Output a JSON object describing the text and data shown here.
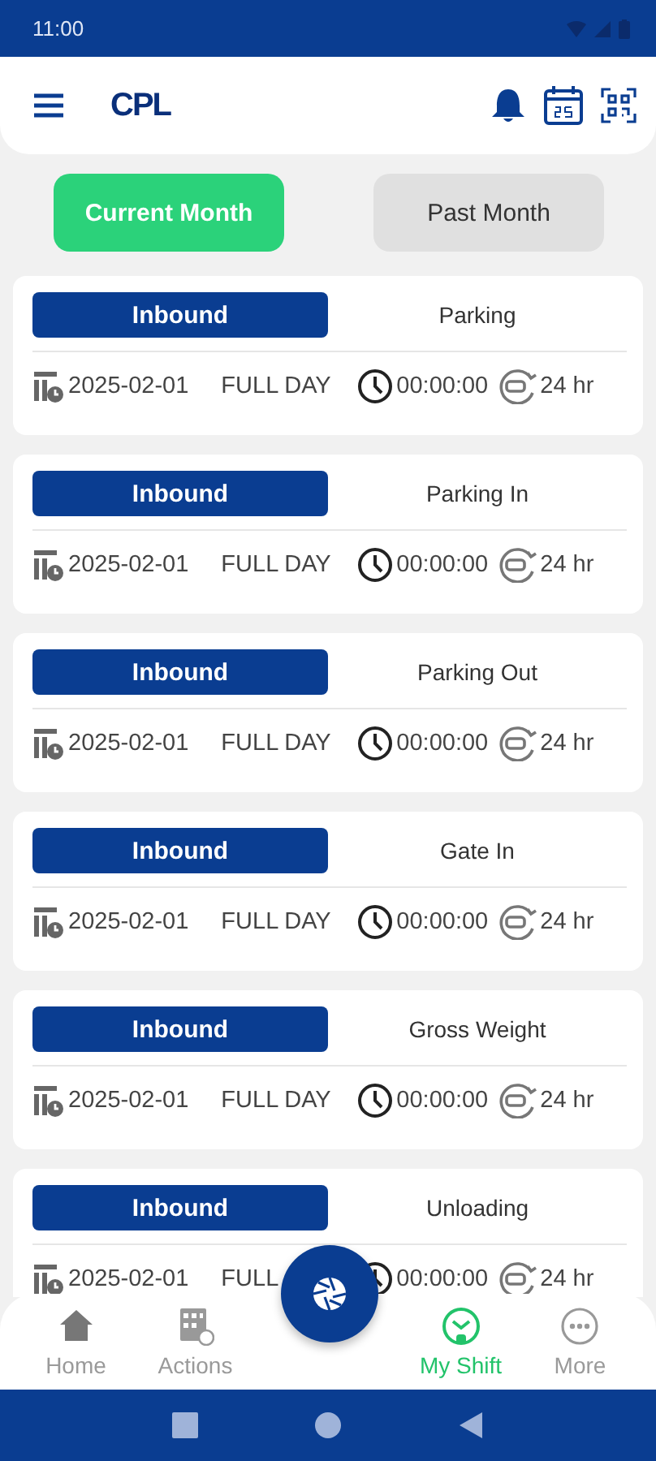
{
  "status_bar": {
    "time": "11:00"
  },
  "header": {
    "logo": "CPL"
  },
  "period_tabs": [
    {
      "label": "Current Month",
      "selected": true
    },
    {
      "label": "Past Month",
      "selected": false
    }
  ],
  "shifts": [
    {
      "direction": "Inbound",
      "location": "Parking",
      "date": "2025-02-01",
      "shift": "FULL DAY",
      "time": "00:00:00",
      "duration": "24 hr"
    },
    {
      "direction": "Inbound",
      "location": "Parking In",
      "date": "2025-02-01",
      "shift": "FULL DAY",
      "time": "00:00:00",
      "duration": "24 hr"
    },
    {
      "direction": "Inbound",
      "location": "Parking Out",
      "date": "2025-02-01",
      "shift": "FULL DAY",
      "time": "00:00:00",
      "duration": "24 hr"
    },
    {
      "direction": "Inbound",
      "location": "Gate In",
      "date": "2025-02-01",
      "shift": "FULL DAY",
      "time": "00:00:00",
      "duration": "24 hr"
    },
    {
      "direction": "Inbound",
      "location": "Gross Weight",
      "date": "2025-02-01",
      "shift": "FULL DAY",
      "time": "00:00:00",
      "duration": "24 hr"
    },
    {
      "direction": "Inbound",
      "location": "Unloading",
      "date": "2025-02-01",
      "shift": "FULL",
      "time": "00:00:00",
      "duration": "24 hr"
    }
  ],
  "bottom_nav": [
    {
      "kind": "home",
      "label": "Home",
      "selected": false
    },
    {
      "kind": "actions",
      "label": "Actions",
      "selected": false
    },
    {
      "kind": "shift",
      "label": "My Shift",
      "selected": true
    },
    {
      "kind": "more",
      "label": "More",
      "selected": false
    }
  ]
}
